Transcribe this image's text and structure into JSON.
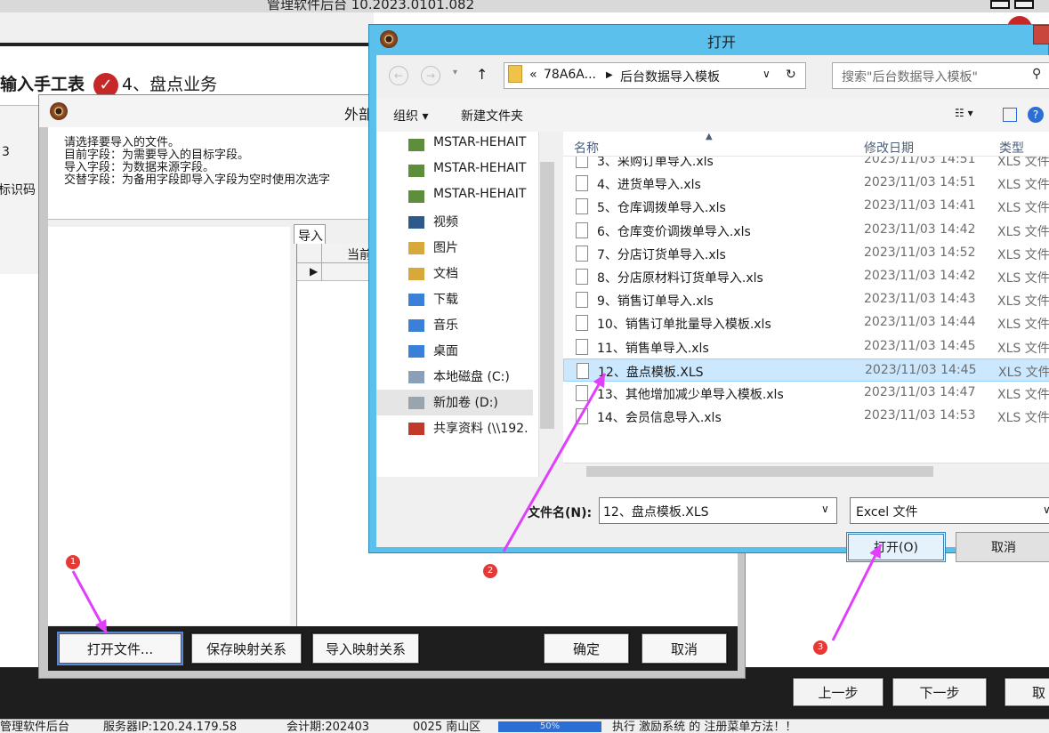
{
  "app": {
    "title": "管理软件后台  10.2023.0101.082",
    "steps": {
      "step3": "输入手工表",
      "step4": "4、盘点业务"
    },
    "left_panel": {
      "cell1": "3",
      "cell2": "标识码"
    },
    "nav": {
      "prev": "上一步",
      "next": "下一步",
      "cancel": "取"
    },
    "status": {
      "seg1": "管理软件后台",
      "seg2": "服务器IP:120.24.179.58",
      "seg3": "会计期:202403",
      "seg4": "0025 南山区",
      "progress_label": "50%",
      "seg5": "执行 激励系统 的 注册菜单方法！！"
    }
  },
  "import_window": {
    "title": "外部",
    "instructions": [
      "请选择要导入的文件。",
      "目前字段：为需要导入的目标字段。",
      "导入字段：为数据来源字段。",
      "交替字段：为备用字段即导入字段为空时使用次选字"
    ],
    "tab": "导入",
    "grid_header": "当前",
    "buttons": {
      "open_file": "打开文件...",
      "save_map": "保存映射关系",
      "import_map": "导入映射关系",
      "ok": "确定",
      "cancel": "取消"
    }
  },
  "open_dialog": {
    "title": "打开",
    "address": {
      "crumb_prefix": "«",
      "crumb1": "78A6A...",
      "crumb2": "后台数据导入模板"
    },
    "search_placeholder": "搜索\"后台数据导入模板\"",
    "commands": {
      "organize": "组织 ▾",
      "new_folder": "新建文件夹"
    },
    "tree": [
      {
        "label": "MSTAR-HEHAIT",
        "icon": "network-computer-icon"
      },
      {
        "label": "MSTAR-HEHAIT",
        "icon": "network-computer-icon"
      },
      {
        "label": "MSTAR-HEHAIT",
        "icon": "network-computer-icon"
      },
      {
        "label": "视频",
        "icon": "videos-folder-icon"
      },
      {
        "label": "图片",
        "icon": "pictures-folder-icon"
      },
      {
        "label": "文档",
        "icon": "documents-folder-icon"
      },
      {
        "label": "下载",
        "icon": "downloads-folder-icon"
      },
      {
        "label": "音乐",
        "icon": "music-folder-icon"
      },
      {
        "label": "桌面",
        "icon": "desktop-folder-icon"
      },
      {
        "label": "本地磁盘 (C:)",
        "icon": "local-disk-icon"
      },
      {
        "label": "新加卷 (D:)",
        "icon": "drive-icon"
      },
      {
        "label": "共享资料 (\\\\192.",
        "icon": "network-drive-disconnected-icon"
      }
    ],
    "columns": {
      "name": "名称",
      "modified": "修改日期",
      "type": "类型"
    },
    "files": [
      {
        "name": "3、采购订单导入.xls",
        "date": "2023/11/03 14:51",
        "type": "XLS 文件"
      },
      {
        "name": "4、进货单导入.xls",
        "date": "2023/11/03 14:51",
        "type": "XLS 文件"
      },
      {
        "name": "5、仓库调拨单导入.xls",
        "date": "2023/11/03 14:41",
        "type": "XLS 文件"
      },
      {
        "name": "6、仓库变价调拨单导入.xls",
        "date": "2023/11/03 14:42",
        "type": "XLS 文件"
      },
      {
        "name": "7、分店订货单导入.xls",
        "date": "2023/11/03 14:52",
        "type": "XLS 文件"
      },
      {
        "name": "8、分店原材料订货单导入.xls",
        "date": "2023/11/03 14:42",
        "type": "XLS 文件"
      },
      {
        "name": "9、销售订单导入.xls",
        "date": "2023/11/03 14:43",
        "type": "XLS 文件"
      },
      {
        "name": "10、销售订单批量导入模板.xls",
        "date": "2023/11/03 14:44",
        "type": "XLS 文件"
      },
      {
        "name": "11、销售单导入.xls",
        "date": "2023/11/03 14:45",
        "type": "XLS 文件"
      },
      {
        "name": "12、盘点模板.XLS",
        "date": "2023/11/03 14:45",
        "type": "XLS 文件"
      },
      {
        "name": "13、其他增加减少单导入模板.xls",
        "date": "2023/11/03 14:47",
        "type": "XLS 文件"
      },
      {
        "name": "14、会员信息导入.xls",
        "date": "2023/11/03 14:53",
        "type": "XLS 文件"
      }
    ],
    "selected_index": 9,
    "filename_label": "文件名(N):",
    "filename_value": "12、盘点模板.XLS",
    "filetype_value": "Excel 文件",
    "buttons": {
      "open": "打开(O)",
      "cancel": "取消"
    }
  },
  "annotations": {
    "badge1": "1",
    "badge2": "2",
    "badge3": "3",
    "arrow_color": "#e040fb",
    "badge_color": "#e53935"
  }
}
